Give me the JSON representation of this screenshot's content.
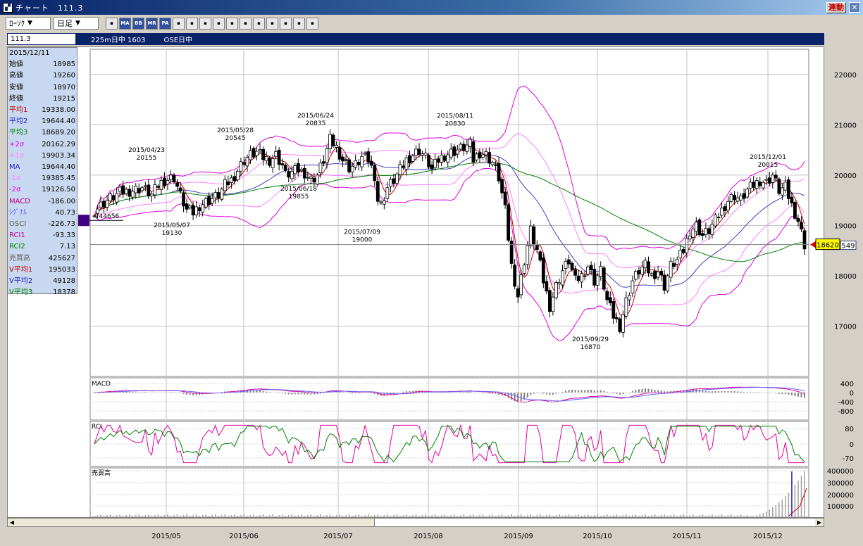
{
  "window": {
    "title": "チャート　111.3",
    "link_button": "連動",
    "close": "✕"
  },
  "toolbar": {
    "chart_type": "ﾛｰｿｸ",
    "period": "日足",
    "dropdown_arrow": "▼",
    "buttons": [
      "settings-icon",
      "MA",
      "BB",
      "MR",
      "PA",
      "line-icon",
      "zoom-in-icon",
      "compare-icon",
      "search-icon",
      "grid-icon",
      "split-icon",
      "pencil-icon",
      "cursor-icon",
      "eraser-icon",
      "tool-icon",
      "fib-icon"
    ]
  },
  "infobar": {
    "code": "111.3",
    "index": "225m日中 1603",
    "market": "OSE日中"
  },
  "datapanel": {
    "date": "2015/12/11",
    "rows": [
      {
        "label": "始値",
        "value": "18985",
        "color": "#000000"
      },
      {
        "label": "高値",
        "value": "19260",
        "color": "#000000"
      },
      {
        "label": "安値",
        "value": "18970",
        "color": "#000000"
      },
      {
        "label": "終値",
        "value": "19215",
        "color": "#000000"
      },
      {
        "label": "平均1",
        "value": "19338.00",
        "color": "#c00000"
      },
      {
        "label": "平均2",
        "value": "19644.40",
        "color": "#2020c0"
      },
      {
        "label": "平均3",
        "value": "18689.20",
        "color": "#008000"
      },
      {
        "label": "+2σ",
        "value": "20162.29",
        "color": "#e000e0"
      },
      {
        "label": "+1σ",
        "value": "19903.34",
        "color": "#ff80ff"
      },
      {
        "label": "MA",
        "value": "19644.40",
        "color": "#2020c0"
      },
      {
        "label": "-1σ",
        "value": "19385.45",
        "color": "#ff80ff"
      },
      {
        "label": "-2σ",
        "value": "19126.50",
        "color": "#e000e0"
      },
      {
        "label": "MACD",
        "value": "-186.00",
        "color": "#c00080"
      },
      {
        "label": "ｼｸﾞﾅﾙ",
        "value": "40.73",
        "color": "#6060ff"
      },
      {
        "label": "OSCI",
        "value": "-226.73",
        "color": "#606060"
      },
      {
        "label": "RCI1",
        "value": "-93.33",
        "color": "#c00080"
      },
      {
        "label": "RCI2",
        "value": "7.13",
        "color": "#008000"
      },
      {
        "label": "売買高",
        "value": "425627",
        "color": "#606060"
      },
      {
        "label": "V平均1",
        "value": "195033",
        "color": "#c00000"
      },
      {
        "label": "V平均2",
        "value": "49128",
        "color": "#2020c0"
      },
      {
        "label": "V平均3",
        "value": "18378",
        "color": "#008000"
      }
    ]
  },
  "chart_data": {
    "type": "candlestick",
    "ylim": [
      16000,
      22500
    ],
    "yticks": [
      17000,
      18000,
      19000,
      20000,
      21000,
      22000
    ],
    "x_months": [
      "2015/05",
      "2015/06",
      "2015/07",
      "2015/08",
      "2015/09",
      "2015/10",
      "2015/11",
      "2015/12"
    ],
    "price_marker": "18620",
    "price_marker_right": "549",
    "left_marker": "744656",
    "annotations": [
      {
        "date": "2015/04/23",
        "value": "20155",
        "pos": "above"
      },
      {
        "date": "2015/05/07",
        "value": "19130",
        "pos": "below"
      },
      {
        "date": "2015/05/28",
        "value": "20545",
        "pos": "above"
      },
      {
        "date": "2015/06/18",
        "value": "19855",
        "pos": "below"
      },
      {
        "date": "2015/06/24",
        "value": "20835",
        "pos": "above"
      },
      {
        "date": "2015/07/09",
        "value": "19000",
        "pos": "below"
      },
      {
        "date": "2015/08/11",
        "value": "20830",
        "pos": "above"
      },
      {
        "date": "2015/09/29",
        "value": "16870",
        "pos": "below"
      },
      {
        "date": "2015/12/01",
        "value": "20015",
        "pos": "above"
      }
    ],
    "close_path": [
      [
        0,
        19300
      ],
      [
        4,
        19500
      ],
      [
        8,
        19650
      ],
      [
        12,
        19700
      ],
      [
        15,
        19750
      ],
      [
        18,
        19600
      ],
      [
        20,
        19800
      ],
      [
        22,
        19900
      ],
      [
        25,
        19950
      ],
      [
        27,
        19600
      ],
      [
        29,
        19300
      ],
      [
        31,
        19250
      ],
      [
        33,
        19400
      ],
      [
        36,
        19500
      ],
      [
        39,
        19600
      ],
      [
        41,
        19800
      ],
      [
        43,
        19900
      ],
      [
        45,
        20100
      ],
      [
        47,
        20300
      ],
      [
        49,
        20400
      ],
      [
        51,
        20450
      ],
      [
        53,
        20350
      ],
      [
        55,
        20300
      ],
      [
        57,
        20400
      ],
      [
        59,
        20200
      ],
      [
        60,
        20000
      ],
      [
        62,
        20050
      ],
      [
        64,
        20100
      ],
      [
        66,
        20050
      ],
      [
        68,
        19900
      ],
      [
        70,
        20000
      ],
      [
        72,
        20300
      ],
      [
        74,
        20700
      ],
      [
        76,
        20550
      ],
      [
        78,
        20300
      ],
      [
        80,
        20150
      ],
      [
        82,
        20200
      ],
      [
        84,
        20350
      ],
      [
        86,
        20300
      ],
      [
        88,
        20000
      ],
      [
        89,
        19500
      ],
      [
        90,
        19400
      ],
      [
        92,
        19750
      ],
      [
        94,
        19900
      ],
      [
        96,
        20100
      ],
      [
        98,
        20300
      ],
      [
        100,
        20400
      ],
      [
        102,
        20500
      ],
      [
        104,
        20350
      ],
      [
        106,
        20100
      ],
      [
        108,
        20300
      ],
      [
        110,
        20400
      ],
      [
        112,
        20450
      ],
      [
        114,
        20500
      ],
      [
        116,
        20550
      ],
      [
        118,
        20600
      ],
      [
        119,
        20300
      ],
      [
        121,
        20450
      ],
      [
        123,
        20400
      ],
      [
        125,
        20250
      ],
      [
        127,
        19950
      ],
      [
        129,
        19300
      ],
      [
        131,
        18200
      ],
      [
        133,
        17600
      ],
      [
        135,
        18300
      ],
      [
        137,
        18900
      ],
      [
        139,
        18500
      ],
      [
        141,
        17900
      ],
      [
        143,
        17400
      ],
      [
        145,
        17800
      ],
      [
        147,
        18100
      ],
      [
        149,
        18300
      ],
      [
        151,
        17900
      ],
      [
        153,
        18000
      ],
      [
        155,
        18200
      ],
      [
        157,
        17900
      ],
      [
        159,
        18100
      ],
      [
        161,
        17500
      ],
      [
        163,
        17200
      ],
      [
        165,
        17000
      ],
      [
        167,
        17500
      ],
      [
        169,
        17900
      ],
      [
        171,
        18100
      ],
      [
        173,
        18200
      ],
      [
        175,
        18000
      ],
      [
        177,
        18100
      ],
      [
        179,
        17800
      ],
      [
        181,
        18200
      ],
      [
        183,
        18300
      ],
      [
        185,
        18500
      ],
      [
        187,
        18900
      ],
      [
        189,
        19000
      ],
      [
        191,
        18800
      ],
      [
        193,
        18900
      ],
      [
        195,
        19100
      ],
      [
        197,
        19300
      ],
      [
        199,
        19500
      ],
      [
        201,
        19600
      ],
      [
        203,
        19500
      ],
      [
        205,
        19700
      ],
      [
        207,
        19800
      ],
      [
        209,
        19900
      ],
      [
        211,
        19850
      ],
      [
        213,
        20000
      ],
      [
        215,
        19700
      ],
      [
        217,
        19750
      ],
      [
        219,
        19400
      ],
      [
        221,
        19100
      ],
      [
        223,
        18620
      ]
    ]
  },
  "macd_panel": {
    "label": "MACD",
    "yticks": [
      "400",
      "0",
      "-400",
      "-800"
    ]
  },
  "rci_panel": {
    "label": "RCI",
    "yticks": [
      "80",
      "0",
      "-70"
    ]
  },
  "volume_panel": {
    "label": "売買高",
    "yticks": [
      "400000",
      "300000",
      "200000",
      "100000"
    ]
  },
  "scroll": {
    "left": "◀",
    "right": "▶"
  }
}
